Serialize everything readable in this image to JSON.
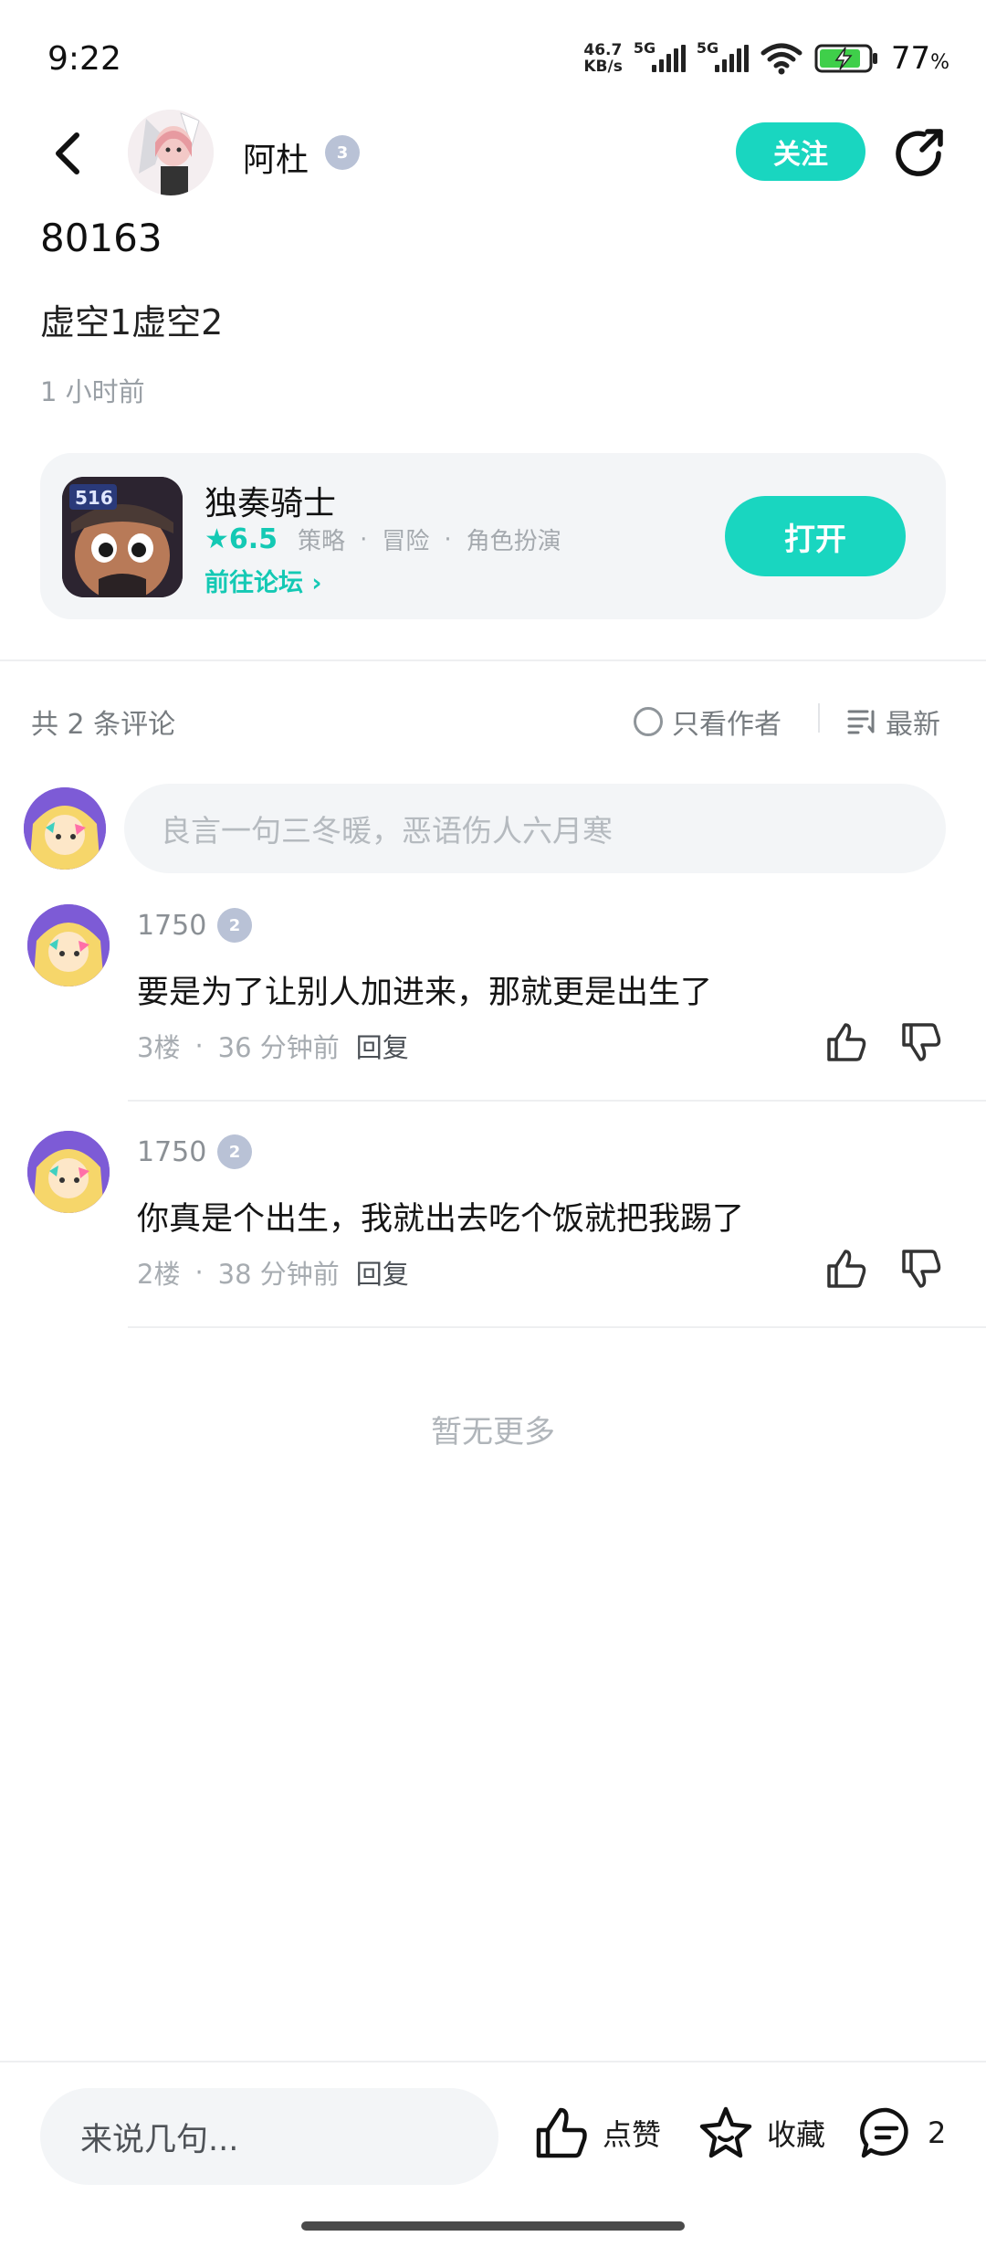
{
  "status_bar": {
    "time": "9:22",
    "speed_value": "46.7",
    "speed_unit": "KB/s",
    "net1": "5G",
    "net2": "5G",
    "battery_pct": "77",
    "battery_unit": "%"
  },
  "header": {
    "author_name": "阿杜",
    "author_level": "3",
    "follow_label": "关注"
  },
  "post": {
    "title": "80163",
    "body": "虚空1虚空2",
    "time": "1 小时前"
  },
  "game": {
    "icon_text": "516",
    "name": "独奏骑士",
    "rating": "★6.5",
    "tags": [
      "策略",
      "冒险",
      "角色扮演"
    ],
    "forum_link": "前往论坛 ›",
    "open_label": "打开"
  },
  "comments_bar": {
    "count": "共 2 条评论",
    "only_author": "只看作者",
    "sort": "最新"
  },
  "comment_input_placeholder": "良言一句三冬暖，恶语伤人六月寒",
  "comments": [
    {
      "user": "1750",
      "level": "2",
      "text": "要是为了让别人加进来，那就更是出生了",
      "floor": "3楼",
      "time": "36 分钟前",
      "reply": "回复"
    },
    {
      "user": "1750",
      "level": "2",
      "text": "你真是个出生，我就出去吃个饭就把我踢了",
      "floor": "2楼",
      "time": "38 分钟前",
      "reply": "回复"
    }
  ],
  "no_more": "暂无更多",
  "bottom_bar": {
    "input_placeholder": "来说几句...",
    "like_label": "点赞",
    "collect_label": "收藏",
    "comment_count": "2"
  },
  "colors": {
    "accent": "#19d6c0",
    "accent_text": "#14c9b4"
  }
}
